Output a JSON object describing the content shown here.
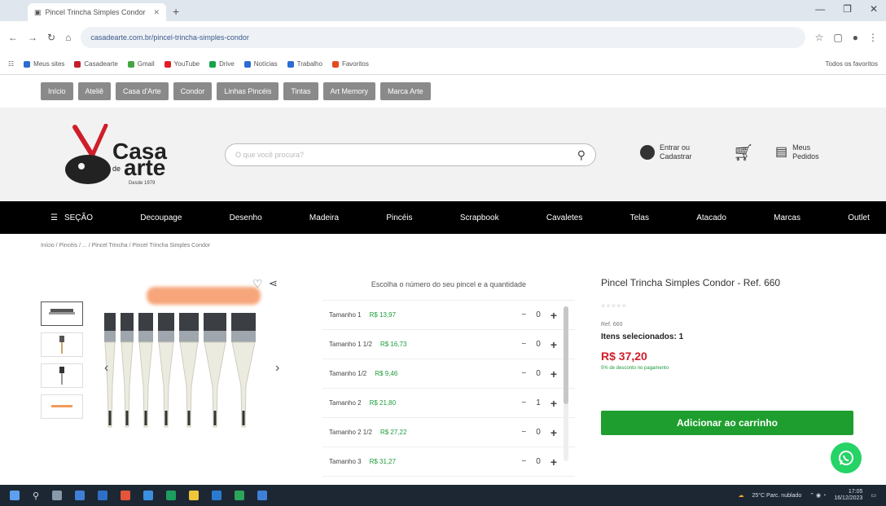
{
  "browser": {
    "tab_title": "Pincel Trincha Simples Condor",
    "url": "casadearte.com.br/pincel-trincha-simples-condor",
    "bookmarks": [
      {
        "label": "Meus sites",
        "color": "#2b6cd4"
      },
      {
        "label": "Casadearte",
        "color": "#c21f2a"
      },
      {
        "label": "Gmail",
        "color": "#46a543"
      },
      {
        "label": "YouTube",
        "color": "#e21c24"
      },
      {
        "label": "Drive",
        "color": "#17a34a"
      },
      {
        "label": "Notícias",
        "color": "#2b6cd4"
      },
      {
        "label": "Trabalho",
        "color": "#2b6cd4"
      },
      {
        "label": "Favoritos",
        "color": "#e34a1f"
      }
    ],
    "other_bookmarks": "Todos os favoritos"
  },
  "pills": [
    "Início",
    "Ateliê",
    "Casa d'Arte",
    "Condor",
    "Linhas Pincéis",
    "Tintas",
    "Art Memory",
    "Marca Arte"
  ],
  "header": {
    "logo_casa": "Casa",
    "logo_de": "de",
    "logo_arte": "arte",
    "logo_since": "Desde 1979",
    "search_placeholder": "O que você procura?",
    "login_line1": "Entrar ou",
    "login_line2": "Cadastrar",
    "orders_line1": "Meus",
    "orders_line2": "Pedidos"
  },
  "nav": {
    "menu_label": "SEÇÃO",
    "items": [
      "Decoupage",
      "Desenho",
      "Madeira",
      "Pincéis",
      "Scrapbook",
      "Cavaletes",
      "Telas",
      "Atacado",
      "Marcas",
      "Outlet"
    ]
  },
  "breadcrumb": "Início / Pincéis / ... / Pincel Trincha / Pincel Trincha Simples Condor",
  "sizes": {
    "title": "Escolha o número do seu pincel e a quantidade",
    "rows": [
      {
        "label": "Tamanho 1",
        "price": "R$ 13,97",
        "qty": "0"
      },
      {
        "label": "Tamanho 1 1/2",
        "price": "R$ 16,73",
        "qty": "0"
      },
      {
        "label": "Tamanho 1/2",
        "price": "R$ 9,46",
        "qty": "0"
      },
      {
        "label": "Tamanho 2",
        "price": "R$ 21,80",
        "qty": "1"
      },
      {
        "label": "Tamanho 2 1/2",
        "price": "R$ 27,22",
        "qty": "0"
      },
      {
        "label": "Tamanho 3",
        "price": "R$ 31,27",
        "qty": "0"
      }
    ]
  },
  "product": {
    "name": "Pincel Trincha Simples Condor - Ref. 660",
    "rating_text": "☆☆☆☆☆",
    "ref": "Ref. 660",
    "selected": "Itens selecionados: 1",
    "total": "R$ 37,20",
    "discount": "5% de desconto no pagamento",
    "add_button": "Adicionar ao carrinho"
  },
  "taskbar": {
    "weather": "25°C Parc. nublado",
    "time": "17:05",
    "date": "16/12/2023"
  },
  "colors": {
    "green": "#1e9e2e",
    "red": "#d01d2a",
    "nav": "#000000"
  }
}
